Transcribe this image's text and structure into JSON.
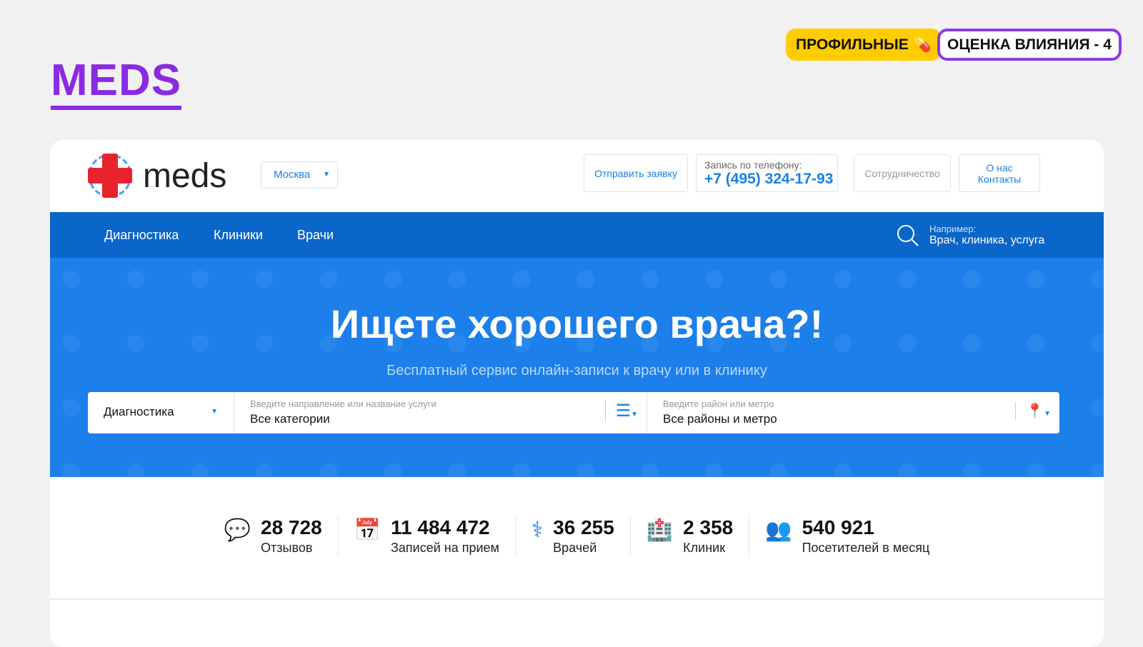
{
  "brand": "MEDS",
  "tags": {
    "profile": "ПРОФИЛЬНЫЕ",
    "impact": "ОЦЕНКА ВЛИЯНИЯ - 4"
  },
  "header": {
    "logo": "meds",
    "city": "Москва",
    "send": "Отправить заявку",
    "phone_label": "Запись по телефону:",
    "phone": "+7 (495) 324-17-93",
    "coop": "Сотрудничество",
    "about": "О нас",
    "contacts": "Контакты"
  },
  "nav": {
    "items": [
      "Диагностика",
      "Клиники",
      "Врачи"
    ],
    "search_hint": "Например:",
    "search_example": "Врач, клиника, услуга"
  },
  "hero": {
    "title": "Ищете хорошего врача?!",
    "subtitle": "Бесплатный сервис онлайн-записи к врачу или в клинику",
    "type": "Диагностика",
    "service_placeholder": "Введите направление или название услуги",
    "service_value": "Все категории",
    "area_placeholder": "Введите район или метро",
    "area_value": "Все районы и метро"
  },
  "stats": [
    {
      "value": "28 728",
      "label": "Отзывов"
    },
    {
      "value": "11 484 472",
      "label": "Записей на прием"
    },
    {
      "value": "36 255",
      "label": "Врачей"
    },
    {
      "value": "2 358",
      "label": "Клиник"
    },
    {
      "value": "540 921",
      "label": "Посетителей в месяц"
    }
  ]
}
